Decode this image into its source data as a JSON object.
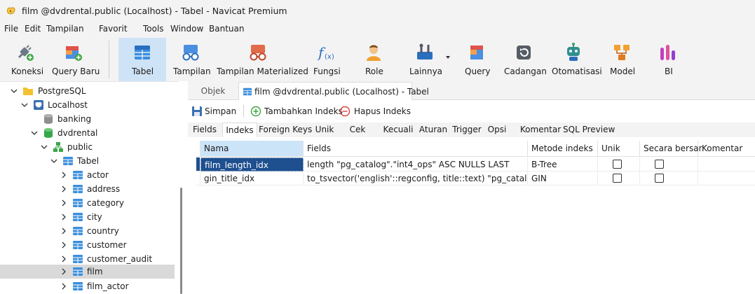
{
  "window": {
    "title": "film @dvdrental.public (Localhost) - Tabel - Navicat Premium"
  },
  "menu": [
    "File",
    "Edit",
    "Tampilan",
    "Favorit",
    "Tools",
    "Window",
    "Bantuan"
  ],
  "toolbar": [
    {
      "label": "Koneksi",
      "icon": "plug-icon"
    },
    {
      "label": "Query Baru",
      "icon": "new-query-icon"
    },
    {
      "label": "Tabel",
      "icon": "table-icon",
      "active": true
    },
    {
      "label": "Tampilan",
      "icon": "view-glasses-icon"
    },
    {
      "label": "Tampilan Materialized",
      "icon": "materialized-view-icon"
    },
    {
      "label": "Fungsi",
      "icon": "function-icon"
    },
    {
      "label": "Role",
      "icon": "user-role-icon"
    },
    {
      "label": "Lainnya",
      "icon": "tools-icon"
    },
    {
      "label": "Query",
      "icon": "query-icon"
    },
    {
      "label": "Cadangan",
      "icon": "backup-icon"
    },
    {
      "label": "Otomatisasi",
      "icon": "robot-icon"
    },
    {
      "label": "Model",
      "icon": "model-icon"
    },
    {
      "label": "BI",
      "icon": "bi-chart-icon"
    }
  ],
  "tree": [
    {
      "label": "PostgreSQL",
      "icon": "folder-icon",
      "level": 0,
      "expanded": true
    },
    {
      "label": "Localhost",
      "icon": "postgres-server-icon",
      "level": 1,
      "expanded": true
    },
    {
      "label": "banking",
      "icon": "database-gray-icon",
      "level": 2,
      "expanded": null
    },
    {
      "label": "dvdrental",
      "icon": "database-green-icon",
      "level": 2,
      "expanded": true
    },
    {
      "label": "public",
      "icon": "schema-icon",
      "level": 3,
      "expanded": true
    },
    {
      "label": "Tabel",
      "icon": "table-group-icon",
      "level": 4,
      "expanded": true
    },
    {
      "label": "actor",
      "icon": "table-icon",
      "level": 5,
      "expanded": false
    },
    {
      "label": "address",
      "icon": "table-icon",
      "level": 5,
      "expanded": false
    },
    {
      "label": "category",
      "icon": "table-icon",
      "level": 5,
      "expanded": false
    },
    {
      "label": "city",
      "icon": "table-icon",
      "level": 5,
      "expanded": false
    },
    {
      "label": "country",
      "icon": "table-icon",
      "level": 5,
      "expanded": false
    },
    {
      "label": "customer",
      "icon": "table-icon",
      "level": 5,
      "expanded": false
    },
    {
      "label": "customer_audit",
      "icon": "table-icon",
      "level": 5,
      "expanded": false
    },
    {
      "label": "film",
      "icon": "table-icon",
      "level": 5,
      "expanded": false,
      "selected": true
    },
    {
      "label": "film_actor",
      "icon": "table-icon",
      "level": 5,
      "expanded": false
    }
  ],
  "tabs": {
    "object": "Objek",
    "document": "film @dvdrental.public (Localhost) - Tabel"
  },
  "actions": {
    "save": "Simpan",
    "add_index": "Tambahkan Indeks",
    "delete_index": "Hapus Indeks"
  },
  "subtabs": [
    "Fields",
    "Indeks",
    "Foreign Keys",
    "Unik",
    "Cek",
    "Kecuali",
    "Aturan",
    "Trigger",
    "Opsi",
    "Komentar",
    "SQL Preview"
  ],
  "active_subtab": "Indeks",
  "grid": {
    "columns": [
      "Nama",
      "Fields",
      "Metode indeks",
      "Unik",
      "Secara bersar",
      "Komentar"
    ],
    "rows": [
      {
        "name": "film_length_idx",
        "fields": "length \"pg_catalog\".\"int4_ops\" ASC NULLS LAST",
        "method": "B-Tree",
        "unique": false,
        "concurrent": false,
        "comment": "",
        "selected": true
      },
      {
        "name": "gin_title_idx",
        "fields": "to_tsvector('english'::regconfig, title::text) \"pg_catalog\".\"tsv",
        "method": "GIN",
        "unique": false,
        "concurrent": false,
        "comment": "",
        "selected": false
      }
    ]
  }
}
